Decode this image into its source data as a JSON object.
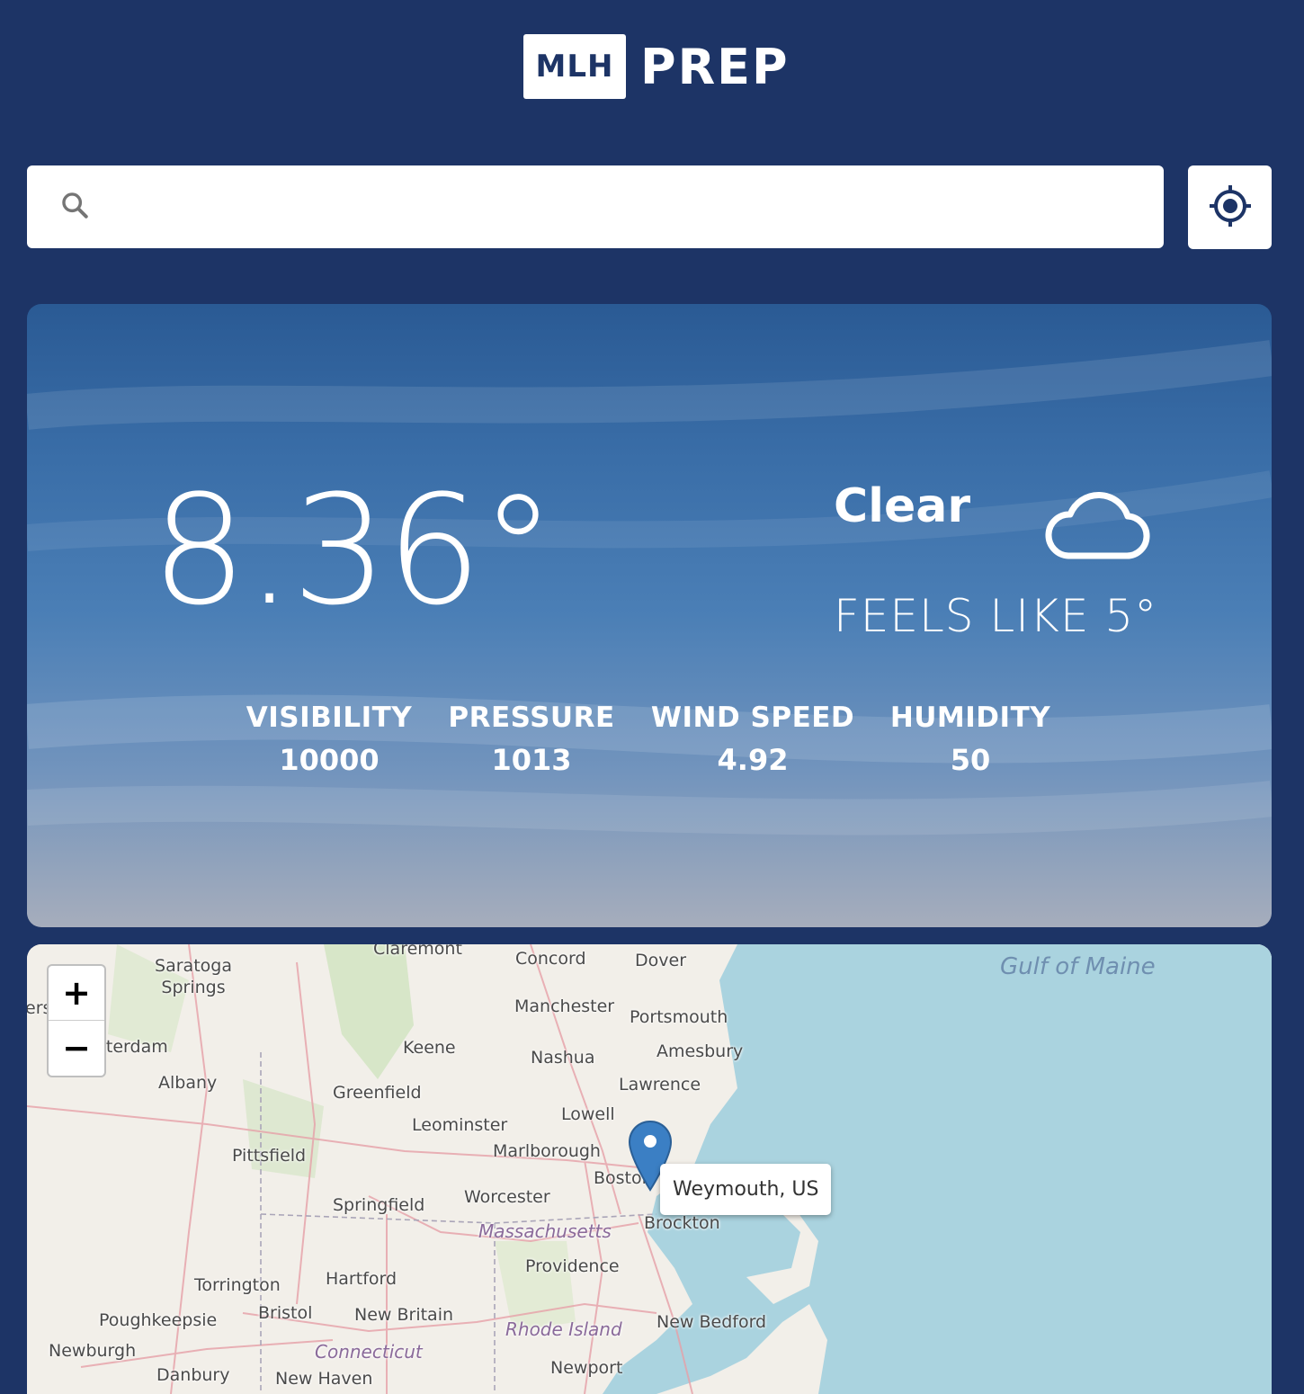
{
  "header": {
    "logo_mark": "MLH",
    "logo_text": "PREP"
  },
  "search": {
    "placeholder": "",
    "value": ""
  },
  "weather": {
    "temperature": "8.36°",
    "condition": "Clear",
    "feels_like": "FEELS LIKE 5°",
    "stats": [
      {
        "label": "VISIBILITY",
        "value": "10000"
      },
      {
        "label": "PRESSURE",
        "value": "1013"
      },
      {
        "label": "WIND SPEED",
        "value": "4.92"
      },
      {
        "label": "HUMIDITY",
        "value": "50"
      }
    ]
  },
  "map": {
    "zoom_in": "+",
    "zoom_out": "−",
    "popup": "Weymouth, US",
    "sea_label": "Gulf of Maine",
    "cities": [
      "Saratoga Springs",
      "Claremont",
      "Concord",
      "Dover",
      "Manchester",
      "Portsmouth",
      "Amesbury",
      "Nashua",
      "Keene",
      "Lawrence",
      "Albany",
      "Greenfield",
      "Lowell",
      "Leominster",
      "Marlborough",
      "Boston",
      "Pittsfield",
      "Springfield",
      "Worcester",
      "Brockton",
      "Providence",
      "Torrington",
      "Hartford",
      "Poughkeepsie",
      "Bristol",
      "New Britain",
      "New Bedford",
      "Newburgh",
      "Danbury",
      "New Haven",
      "Newport"
    ],
    "states": [
      "Massachusetts",
      "Rhode Island",
      "Connecticut"
    ],
    "partial_labels": [
      "ers",
      "sterdam"
    ]
  },
  "colors": {
    "background": "#1d3466",
    "sea": "#aad3df",
    "land": "#f2efe9"
  }
}
